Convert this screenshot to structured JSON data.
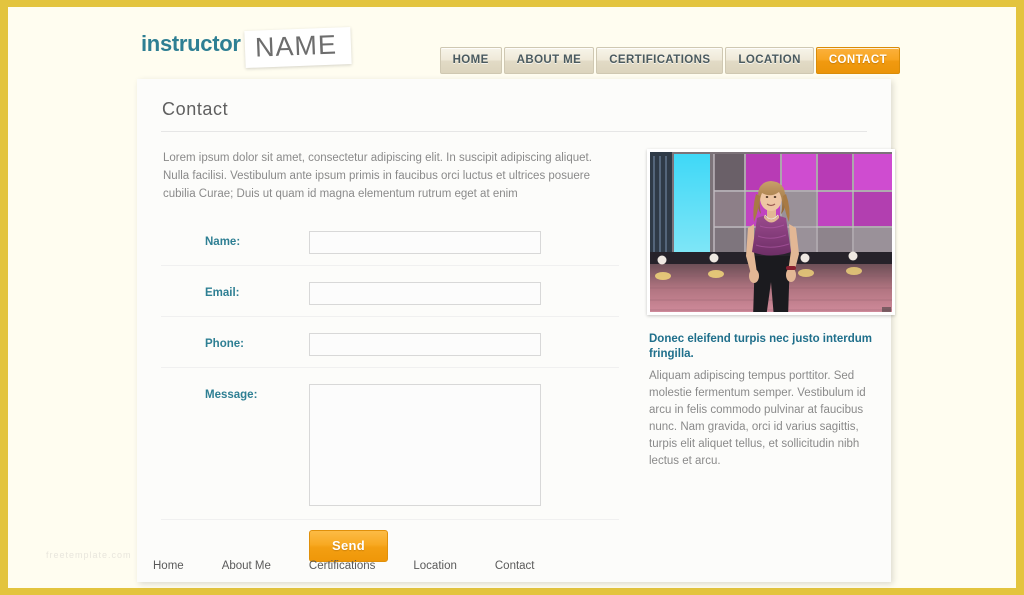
{
  "site": {
    "logo_primary": "instructor",
    "logo_secondary": "NAME",
    "accent_color": "#2e7f93",
    "button_color": "#f5a11a",
    "border_color": "#e3c43e"
  },
  "topnav": {
    "items": [
      {
        "label": "HOME",
        "active": false
      },
      {
        "label": "ABOUT ME",
        "active": false
      },
      {
        "label": "CERTIFICATIONS",
        "active": false
      },
      {
        "label": "LOCATION",
        "active": false
      },
      {
        "label": "CONTACT",
        "active": true
      }
    ]
  },
  "main": {
    "title": "Contact",
    "intro": "Lorem ipsum dolor sit amet, consectetur adipiscing elit. In suscipit adipiscing aliquet. Nulla facilisi. Vestibulum ante ipsum primis in faucibus orci luctus et ultrices posuere cubilia Curae; Duis ut quam id magna elementum rutrum eget at enim"
  },
  "form": {
    "fields": [
      {
        "label": "Name:",
        "value": "",
        "placeholder": ""
      },
      {
        "label": "Email:",
        "value": "",
        "placeholder": ""
      },
      {
        "label": "Phone:",
        "value": "",
        "placeholder": ""
      }
    ],
    "message": {
      "label": "Message:",
      "value": "",
      "placeholder": ""
    },
    "submit_label": "Send"
  },
  "sidebar": {
    "photo_alt": "fitness-instructor-photo",
    "heading": "Donec eleifend turpis nec justo interdum fringilla.",
    "body": "Aliquam adipiscing tempus porttitor. Sed molestie fermentum semper. Vestibulum id arcu in felis commodo pulvinar at faucibus nunc. Nam gravida, orci id varius sagittis, turpis elit aliquet tellus, et sollicitudin nibh lectus et arcu."
  },
  "watermark": {
    "text": "freetemplate.com"
  },
  "footer": {
    "items": [
      {
        "label": "Home"
      },
      {
        "label": "About Me"
      },
      {
        "label": "Certifications"
      },
      {
        "label": "Location"
      },
      {
        "label": "Contact"
      }
    ]
  }
}
